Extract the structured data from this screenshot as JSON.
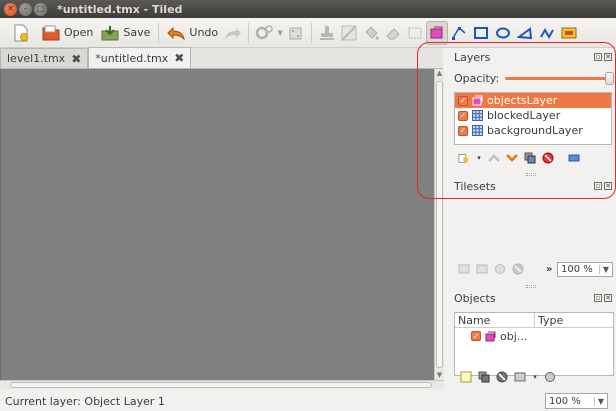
{
  "window": {
    "title": "*untitled.tmx - Tiled"
  },
  "toolbar": {
    "new_label": "",
    "open_label": "Open",
    "save_label": "Save",
    "undo_label": "Undo"
  },
  "tabs": [
    {
      "label": "level1.tmx",
      "active": false
    },
    {
      "label": "*untitled.tmx",
      "active": true
    }
  ],
  "layers_panel": {
    "title": "Layers",
    "opacity_label": "Opacity:",
    "opacity_value": 1.0,
    "layers": [
      {
        "name": "objectsLayer",
        "type": "object",
        "visible": true,
        "selected": true
      },
      {
        "name": "blockedLayer",
        "type": "tile",
        "visible": true,
        "selected": false
      },
      {
        "name": "backgroundLayer",
        "type": "tile",
        "visible": true,
        "selected": false
      }
    ]
  },
  "tilesets_panel": {
    "title": "Tilesets",
    "zoom": "100 %",
    "more": "»"
  },
  "objects_panel": {
    "title": "Objects",
    "columns": [
      "Name",
      "Type"
    ],
    "rows": [
      {
        "name": "obj...",
        "type": ""
      }
    ]
  },
  "status": {
    "text": "Current layer: Object Layer 1",
    "zoom": "100 %"
  },
  "colors": {
    "accent": "#f07746",
    "canvas": "#808080",
    "highlight": "#e3262f"
  }
}
